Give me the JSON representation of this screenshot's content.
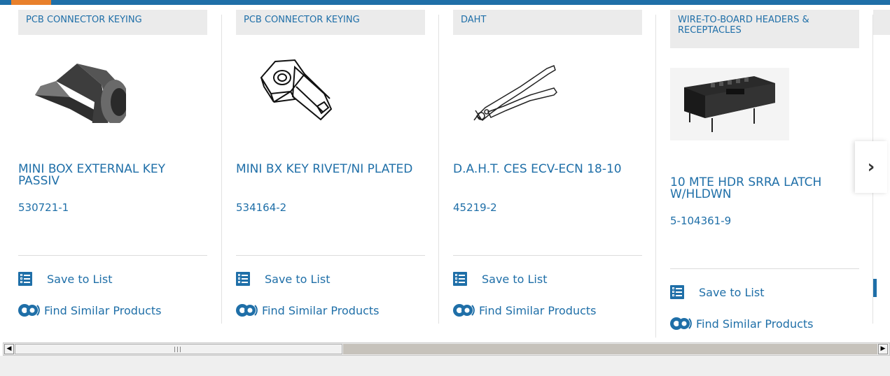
{
  "products": [
    {
      "category": "PCB CONNECTOR KEYING",
      "title": "MINI BOX EXTERNAL KEY PASSIV",
      "part_number": "530721-1",
      "save_label": "Save to List",
      "similar_label": "Find Similar Products",
      "image_icon": "key-block-photo"
    },
    {
      "category": "PCB CONNECTOR KEYING",
      "title": "MINI BX KEY RIVET/NI PLATED",
      "part_number": "534164-2",
      "save_label": "Save to List",
      "similar_label": "Find Similar Products",
      "image_icon": "rivet-line-drawing"
    },
    {
      "category": "DAHT",
      "title": "D.A.H.T. CES ECV-ECN 18-10",
      "part_number": "45219-2",
      "save_label": "Save to List",
      "similar_label": "Find Similar Products",
      "image_icon": "crimp-tool-drawing"
    },
    {
      "category": "WIRE-TO-BOARD HEADERS & RECEPTACLES",
      "title": "10 MTE HDR SRRA LATCH W/HLDWN",
      "part_number": "5-104361-9",
      "save_label": "Save to List",
      "similar_label": "Find Similar Products",
      "image_icon": "header-connector-photo"
    }
  ],
  "next_button": "›",
  "colors": {
    "brand_blue": "#1f6fa8",
    "accent_orange": "#e8802c",
    "category_bg": "#ebebeb"
  },
  "scrollbar": {
    "left_arrow": "◀",
    "right_arrow": "▶"
  }
}
